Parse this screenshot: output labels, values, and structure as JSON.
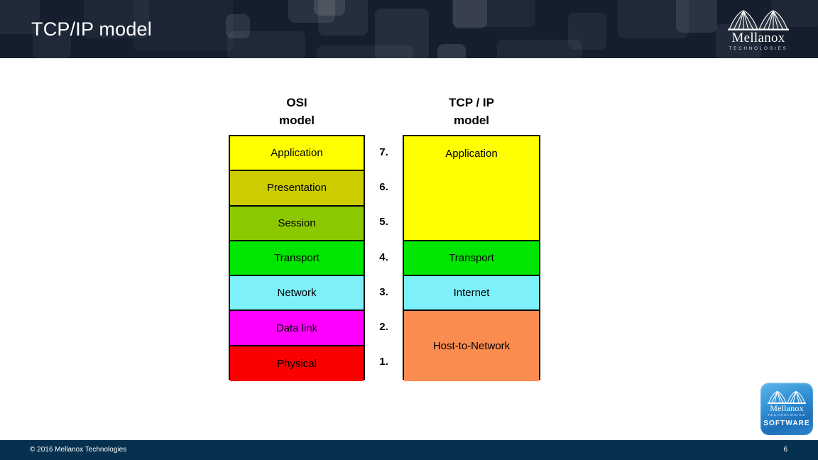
{
  "header": {
    "title": "TCP/IP model",
    "background_color": "#141e2d",
    "logo": {
      "icon": "mellanox-bridge-icon",
      "wordmark": "Mellanox",
      "tagline": "TECHNOLOGIES"
    }
  },
  "diagram": {
    "columns": {
      "osi_heading": "OSI\nmodel",
      "tcpip_heading": "TCP / IP\nmodel"
    },
    "osi_layers": [
      {
        "number": "7.",
        "label": "Application",
        "color": "#ffff00"
      },
      {
        "number": "6.",
        "label": "Presentation",
        "color": "#cccc00"
      },
      {
        "number": "5.",
        "label": "Session",
        "color": "#8cc800"
      },
      {
        "number": "4.",
        "label": "Transport",
        "color": "#00e600"
      },
      {
        "number": "3.",
        "label": "Network",
        "color": "#7df0fa"
      },
      {
        "number": "2.",
        "label": "Data link",
        "color": "#ff00ff"
      },
      {
        "number": "1.",
        "label": "Physical",
        "color": "#fa0000"
      }
    ],
    "tcpip_layers": [
      {
        "label": "Application",
        "color": "#ffff00",
        "spans": 3
      },
      {
        "label": "Transport",
        "color": "#00e600",
        "spans": 1
      },
      {
        "label": "Internet",
        "color": "#7df0fa",
        "spans": 1
      },
      {
        "label": "Host-to-Network",
        "color": "#fa8c50",
        "spans": 2
      }
    ]
  },
  "badge": {
    "icon": "mellanox-bridge-icon",
    "wordmark": "Mellanox",
    "tagline": "TECHNOLOGIES",
    "product": "SOFTWARE"
  },
  "footer": {
    "copyright": "© 2016 Mellanox Technologies",
    "page_number": "6",
    "background_color": "#06304f"
  }
}
